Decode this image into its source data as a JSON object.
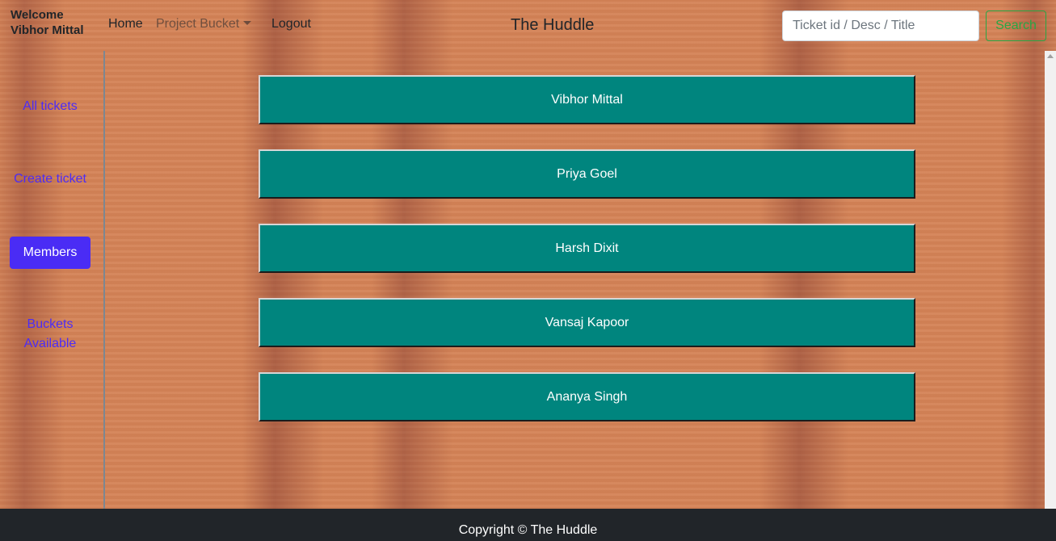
{
  "header": {
    "welcome_line1": "Welcome",
    "welcome_line2": "Vibhor Mittal",
    "nav": {
      "home": "Home",
      "project_bucket": "Project Bucket",
      "logout": "Logout"
    },
    "title": "The Huddle",
    "search": {
      "placeholder": "Ticket id / Desc / Title",
      "value": "",
      "button": "Search"
    }
  },
  "sidebar": {
    "items": [
      {
        "label": "All tickets",
        "active": false
      },
      {
        "label": "Create ticket",
        "active": false
      },
      {
        "label": "Members",
        "active": true
      },
      {
        "label": "Buckets Available",
        "active": false
      }
    ]
  },
  "members": [
    "Vibhor Mittal",
    "Priya Goel",
    "Harsh Dixit",
    "Vansaj Kapoor",
    "Ananya Singh"
  ],
  "footer": {
    "copyright": "Copyright © The Huddle"
  },
  "colors": {
    "member_bg": "#00857e",
    "active_sidebar": "#4a2cf5",
    "link": "#4d2cf5",
    "search_accent": "#28a745",
    "footer_bg": "#212529"
  }
}
